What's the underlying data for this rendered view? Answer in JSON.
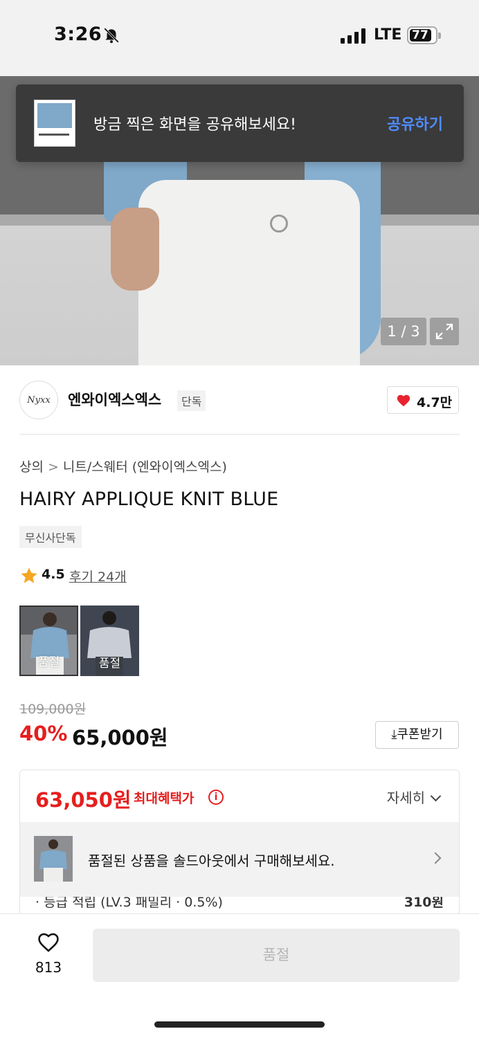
{
  "status_bar": {
    "time": "3:26",
    "network": "LTE",
    "battery": "77"
  },
  "share_toast": {
    "message": "방금 찍은 화면을 공유해보세요!",
    "action": "공유하기"
  },
  "gallery": {
    "pager": "1 / 3"
  },
  "brand": {
    "logo_text": "Nyxx",
    "name": "엔와이엑스엑스",
    "tag": "단독",
    "likes": "4.7만"
  },
  "breadcrumb": {
    "category": "상의",
    "subcategory": "니트/스웨터 (엔와이엑스엑스)"
  },
  "product": {
    "title": "HAIRY APPLIQUE KNIT BLUE",
    "exclusive_tag": "무신사단독",
    "rating": "4.5",
    "reviews": "후기 24개",
    "options": [
      {
        "label": "품절",
        "color": "blue"
      },
      {
        "label": "품절",
        "color": "grey"
      }
    ]
  },
  "price": {
    "original": "109,000원",
    "discount": "40%",
    "sale": "65,000원",
    "coupon_button": "쿠폰받기"
  },
  "benefit": {
    "max_price": "63,050원",
    "label": "최대혜택가",
    "detail_link": "자세히",
    "soldout_banner": "품절된 상품을 솔드아웃에서 구매해보세요.",
    "points_label": "· 등급 적립 (LV.3 패밀리 · 0.5%)",
    "points_value": "310원"
  },
  "bottom_bar": {
    "wish_count": "813",
    "buy_button": "품절"
  },
  "colors": {
    "accent_red": "#e61e1e",
    "link_blue": "#4f8cff",
    "heart_red": "#e8232f"
  }
}
